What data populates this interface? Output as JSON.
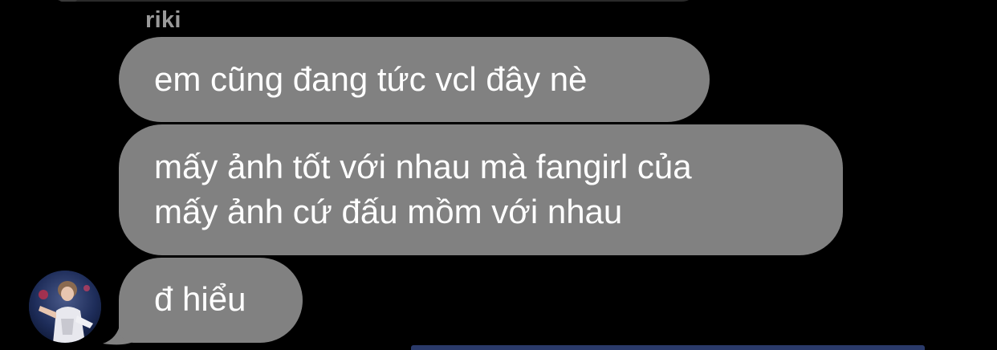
{
  "conversation": {
    "sender_name": "riki",
    "messages": [
      {
        "lines": [
          "em cũng đang tức vcl đây nè"
        ]
      },
      {
        "lines": [
          "mấy ảnh tốt với nhau mà fangirl của",
          "mấy ảnh cứ đấu mồm với nhau"
        ]
      },
      {
        "lines": [
          "đ hiểu"
        ]
      }
    ]
  },
  "colors": {
    "background": "#000000",
    "bubble": "#818181",
    "sender_name": "#9a9a9a",
    "text": "#ffffff"
  },
  "icons": {
    "avatar": "profile-photo"
  }
}
